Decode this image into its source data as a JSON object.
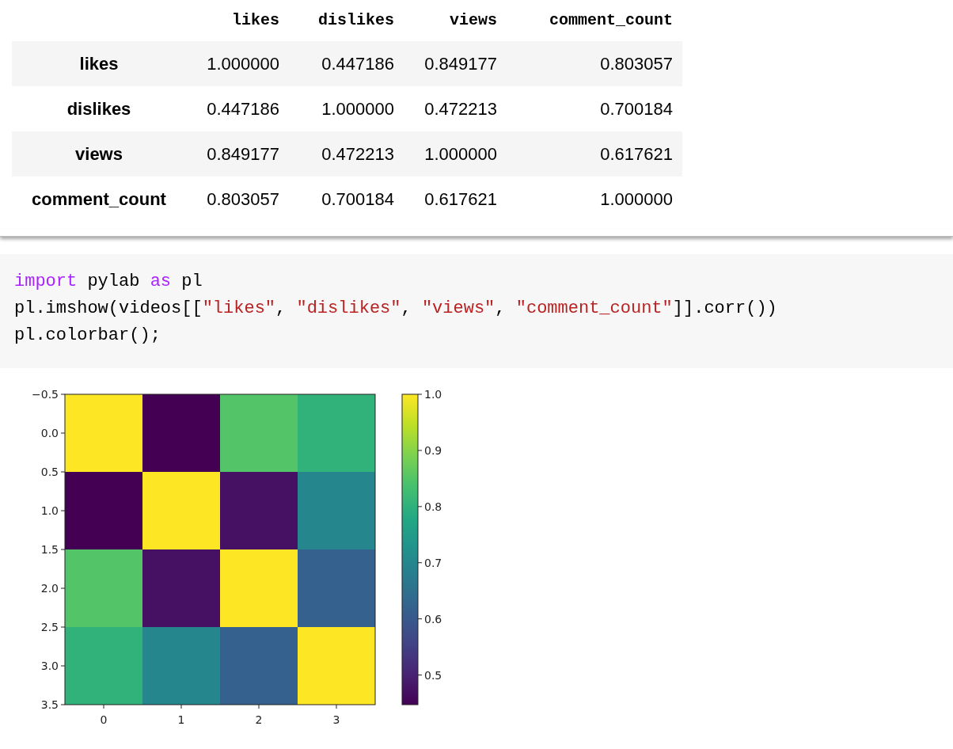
{
  "table": {
    "columns": [
      "likes",
      "dislikes",
      "views",
      "comment_count"
    ],
    "rows": [
      {
        "label": "likes",
        "cells": [
          "1.000000",
          "0.447186",
          "0.849177",
          "0.803057"
        ]
      },
      {
        "label": "dislikes",
        "cells": [
          "0.447186",
          "1.000000",
          "0.472213",
          "0.700184"
        ]
      },
      {
        "label": "views",
        "cells": [
          "0.849177",
          "0.472213",
          "1.000000",
          "0.617621"
        ]
      },
      {
        "label": "comment_count",
        "cells": [
          "0.803057",
          "0.700184",
          "0.617621",
          "1.000000"
        ]
      }
    ]
  },
  "code_cell": {
    "lines": [
      [
        {
          "kind": "keyword",
          "text": "import"
        },
        {
          "kind": "plain",
          "text": " pylab "
        },
        {
          "kind": "keyword",
          "text": "as"
        },
        {
          "kind": "plain",
          "text": " pl"
        }
      ],
      [
        {
          "kind": "plain",
          "text": "pl.imshow(videos[["
        },
        {
          "kind": "string",
          "text": "\"likes\""
        },
        {
          "kind": "plain",
          "text": ", "
        },
        {
          "kind": "string",
          "text": "\"dislikes\""
        },
        {
          "kind": "plain",
          "text": ", "
        },
        {
          "kind": "string",
          "text": "\"views\""
        },
        {
          "kind": "plain",
          "text": ", "
        },
        {
          "kind": "string",
          "text": "\"comment_count\""
        },
        {
          "kind": "plain",
          "text": "]].corr())"
        }
      ],
      [
        {
          "kind": "plain",
          "text": "pl.colorbar();"
        }
      ]
    ]
  },
  "plot": {
    "yticks": [
      "−0.5",
      "0.0",
      "0.5",
      "1.0",
      "1.5",
      "2.0",
      "2.5",
      "3.0",
      "3.5"
    ],
    "xticks": [
      "0",
      "1",
      "2",
      "3"
    ],
    "colorbar_ticks": [
      "1.0",
      "0.9",
      "0.8",
      "0.7",
      "0.6",
      "0.5"
    ]
  }
}
